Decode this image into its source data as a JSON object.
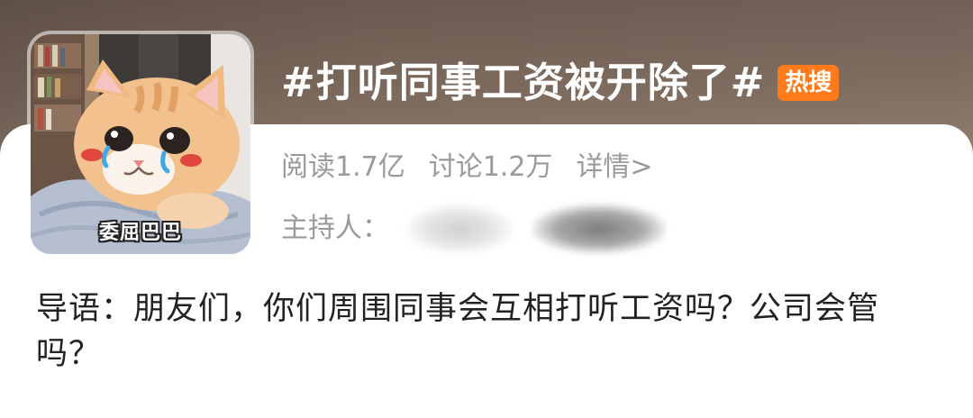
{
  "topic": {
    "title": "#打听同事工资被开除了#",
    "badge": "热搜"
  },
  "avatar": {
    "caption": "委屈巴巴",
    "subject": "crying-cat-sticker"
  },
  "stats": {
    "reads": "阅读1.7亿",
    "discussions": "讨论1.2万",
    "details_link": "详情>"
  },
  "host": {
    "label": "主持人："
  },
  "intro": {
    "text": "导语：朋友们，你们周围同事会互相打听工资吗？公司会管吗？"
  },
  "colors": {
    "badge": "#ff7a1a",
    "meta_text": "#9a9a9a",
    "body_text": "#222222",
    "header_bg": "#7d6a5d"
  }
}
